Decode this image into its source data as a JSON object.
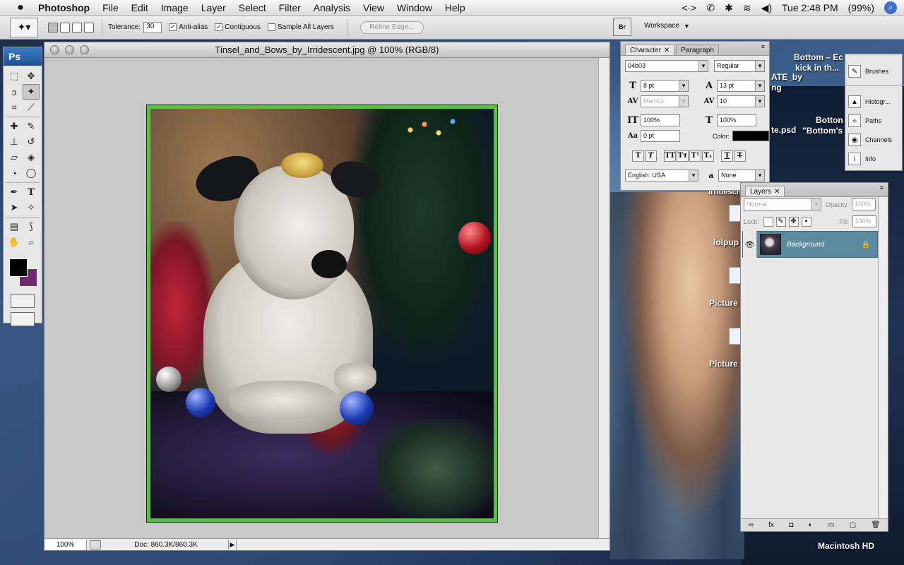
{
  "menubar": {
    "apple_icon": "apple-icon",
    "app_name": "Photoshop",
    "items": [
      "File",
      "Edit",
      "Image",
      "Layer",
      "Select",
      "Filter",
      "Analysis",
      "View",
      "Window",
      "Help"
    ],
    "status": {
      "sync": "<·>",
      "phone": "✆",
      "bluetooth": "✱",
      "wifi": "≋",
      "volume": "◀)",
      "clock": "Tue 2:48 PM",
      "battery": "(99%)",
      "spotlight_glyph": "⌕"
    }
  },
  "options_bar": {
    "tolerance_label": "Tolerance:",
    "tolerance_value": "30",
    "anti_alias_label": "Anti-alias",
    "anti_alias_checked": "✓",
    "contiguous_label": "Contiguous",
    "contiguous_checked": "✓",
    "sample_all_layers_label": "Sample All Layers",
    "refine_edge_label": "Refine Edge...",
    "bridge_label": "Br",
    "workspace_label": "Workspace",
    "workspace_arrow": "▼"
  },
  "toolbox": {
    "logo": "Ps",
    "foreground_color": "#000000",
    "background_color": "#6e2a6f"
  },
  "document": {
    "title": "Tinsel_and_Bows_by_Irridescent.jpg @ 100% (RGB/8)",
    "zoom": "100%",
    "doc_info": "Doc: 860.3K/860.3K",
    "status_arrow": "▶"
  },
  "character_panel": {
    "tabs": [
      "Character",
      "Paragraph"
    ],
    "close_glyph": "✕",
    "font_family": "04b03",
    "font_style": "Regular",
    "font_size": "8 pt",
    "leading": "13 pt",
    "kerning": "Metrics",
    "tracking": "10",
    "vertical_scale": "100%",
    "horizontal_scale": "100%",
    "baseline_shift": "0 pt",
    "color_label": "Color:",
    "text_color": "#000000",
    "language": "English: USA",
    "anti_alias_label": "a",
    "anti_alias_value": "None"
  },
  "layers_panel": {
    "tab": "Layers",
    "blend_mode": "Normal",
    "opacity_label": "Opacity:",
    "opacity_value": "100%",
    "lock_label": "Lock:",
    "fill_label": "Fill:",
    "fill_value": "100%",
    "layers": [
      {
        "name": "Background",
        "visible_glyph": "👁"
      }
    ],
    "footer_glyphs": [
      "∞",
      "fx",
      "◘",
      "◐",
      "▭",
      "▢",
      "🗑"
    ]
  },
  "dock": {
    "items": [
      "Brushes",
      "Histogr...",
      "Paths",
      "Channels",
      "Info"
    ]
  },
  "desktop": {
    "labels": [
      "Bottom – Ec",
      "kick in th...",
      "ATE_by",
      "ng",
      "Botton",
      "\"Bottom's",
      "te.psd",
      "lolpup",
      "Picture",
      "Picture",
      "Irridescn",
      "Macintosh HD"
    ]
  }
}
